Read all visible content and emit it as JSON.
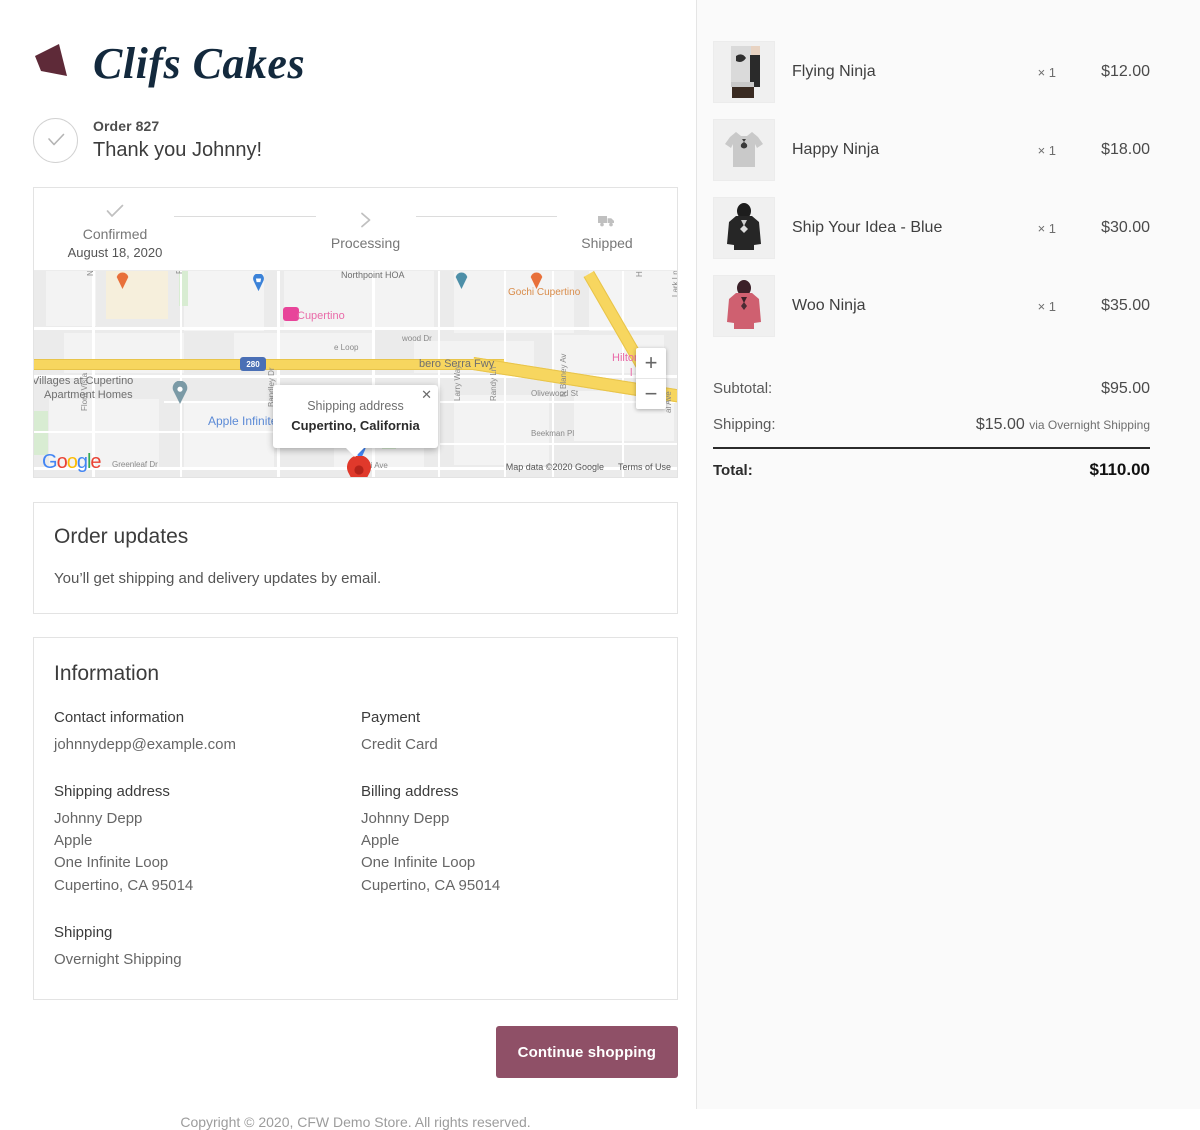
{
  "brand": {
    "name": "Clifs Cakes",
    "mark_color": "#5e2a38"
  },
  "order": {
    "number_label": "Order 827",
    "thanks": "Thank you Johnny!",
    "check_icon": "check-icon"
  },
  "status_steps": [
    {
      "label": "Confirmed",
      "date": "August 18, 2020",
      "icon": "check-icon"
    },
    {
      "label": "Processing",
      "date": "",
      "icon": "chevron-right-icon"
    },
    {
      "label": "Shipped",
      "date": "",
      "icon": "truck-icon"
    }
  ],
  "map": {
    "bubble": {
      "line1": "Shipping address",
      "line2": "Cupertino, California",
      "close_icon": "close-icon"
    },
    "zoom_in": "+",
    "zoom_out": "−",
    "attribution": "Map data ©2020 Google",
    "terms": "Terms of Use",
    "logo_letters": [
      "G",
      "o",
      "o",
      "g",
      "l",
      "e"
    ],
    "labels": [
      "N Stelling Rd",
      "Franco Ct",
      "Northpoint HOA",
      "Gochi Cupertino",
      "Heron Ave",
      "Lark Ln",
      "Cupertino",
      "Serra Fwy",
      "Hilton Ga",
      "Villages at Cupertino",
      "Apartment Homes",
      "Apple Infinite Loop",
      "Olivewood St",
      "Beekman Pl",
      "Larry Way",
      "Randy Ln",
      "N Blaney Av",
      "Greenleaf Dr",
      "Bandley Dr",
      "N De A",
      "Flora Vista",
      "280",
      "wood Dr",
      "mi Ave"
    ]
  },
  "order_updates": {
    "title": "Order updates",
    "text": "You’ll get shipping and delivery updates by email."
  },
  "information": {
    "title": "Information",
    "blocks": [
      {
        "heading": "Contact information",
        "lines": [
          "johnnydepp@example.com"
        ]
      },
      {
        "heading": "Payment",
        "lines": [
          "Credit Card"
        ]
      },
      {
        "heading": "Shipping address",
        "lines": [
          "Johnny Depp",
          "Apple",
          "One Infinite Loop",
          "Cupertino, CA 95014"
        ]
      },
      {
        "heading": "Billing address",
        "lines": [
          "Johnny Depp",
          "Apple",
          "One Infinite Loop",
          "Cupertino, CA 95014"
        ]
      },
      {
        "heading": "Shipping",
        "lines": [
          "Overnight Shipping"
        ]
      }
    ]
  },
  "actions": {
    "continue_shopping": "Continue shopping",
    "button_color": "#8f5067"
  },
  "footer": {
    "copyright": "Copyright © 2020, CFW Demo Store. All rights reserved."
  },
  "cart": {
    "items": [
      {
        "name": "Flying Ninja",
        "qty": "× 1",
        "price": "$12.00",
        "thumb": "person-holding-tshirt-photo"
      },
      {
        "name": "Happy Ninja",
        "qty": "× 1",
        "price": "$18.00",
        "thumb": "grey-tshirt-photo"
      },
      {
        "name": "Ship Your Idea - Blue",
        "qty": "× 1",
        "price": "$30.00",
        "thumb": "black-hoodie-photo"
      },
      {
        "name": "Woo Ninja",
        "qty": "× 1",
        "price": "$35.00",
        "thumb": "red-hoodie-photo"
      }
    ],
    "totals": [
      {
        "label": "Subtotal:",
        "value": "$95.00",
        "note": ""
      },
      {
        "label": "Shipping:",
        "value": "$15.00",
        "note": "via Overnight Shipping"
      }
    ],
    "total": {
      "label": "Total:",
      "value": "$110.00"
    }
  }
}
